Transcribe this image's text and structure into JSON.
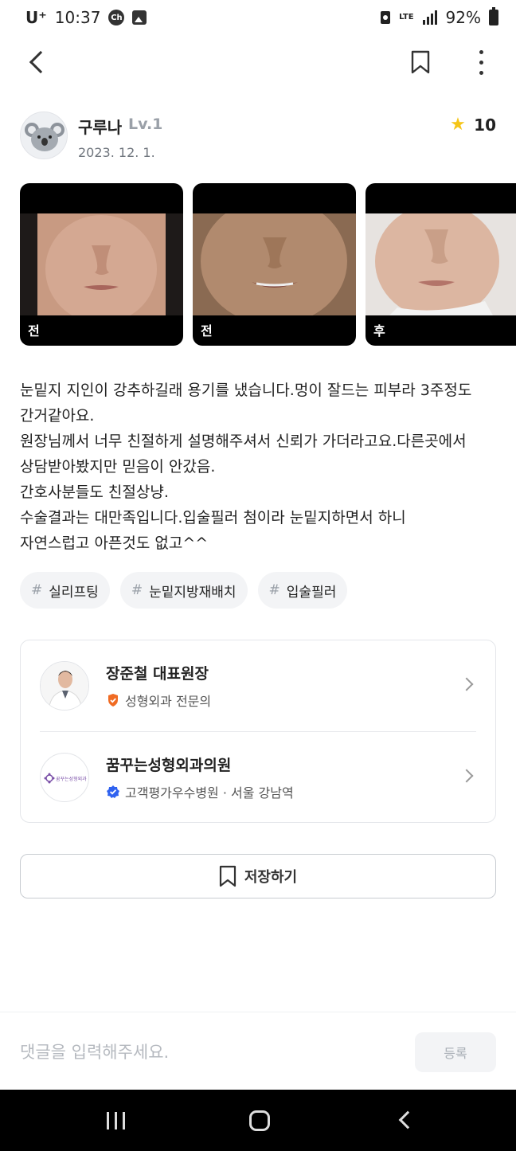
{
  "status_bar": {
    "carrier": "U⁺",
    "time": "10:37",
    "network": "LTE",
    "battery": "92%"
  },
  "author": {
    "name": "구루나",
    "level": "Lv.1",
    "date": "2023. 12. 1.",
    "rating": "10"
  },
  "photos": [
    {
      "label": "전"
    },
    {
      "label": "전"
    },
    {
      "label": "후"
    }
  ],
  "body": [
    "눈밑지 지인이 강추하길래 용기를 냈습니다.멍이 잘드는 피부라 3주정도",
    "간거같아요.",
    "원장님께서 너무 친절하게 설명해주셔서 신뢰가 가더라고요.다른곳에서",
    "상담받아봤지만 믿음이 안갔음.",
    "간호사분들도 친절상냥.",
    "수술결과는 대만족입니다.입술필러 첨이라 눈밑지하면서 하니",
    "자연스럽고 아픈것도 없고^^"
  ],
  "hashtags": [
    {
      "hash": "#",
      "label": "실리프팅"
    },
    {
      "hash": "#",
      "label": "눈밑지방재배치"
    },
    {
      "hash": "#",
      "label": "입술필러"
    }
  ],
  "doctor": {
    "name": "장준철 대표원장",
    "specialty": "성형외과 전문의"
  },
  "clinic": {
    "name": "꿈꾸는성형외과의원",
    "info": "고객평가우수병원 · 서울 강남역",
    "logo_text": "꿈꾸는성형외과"
  },
  "save_label": "저장하기",
  "comment": {
    "placeholder": "댓글을 입력해주세요.",
    "submit_label": "등록"
  },
  "colors": {
    "star": "#f5c518",
    "specialist_badge": "#f06b23",
    "verified_badge": "#2f62f0"
  }
}
